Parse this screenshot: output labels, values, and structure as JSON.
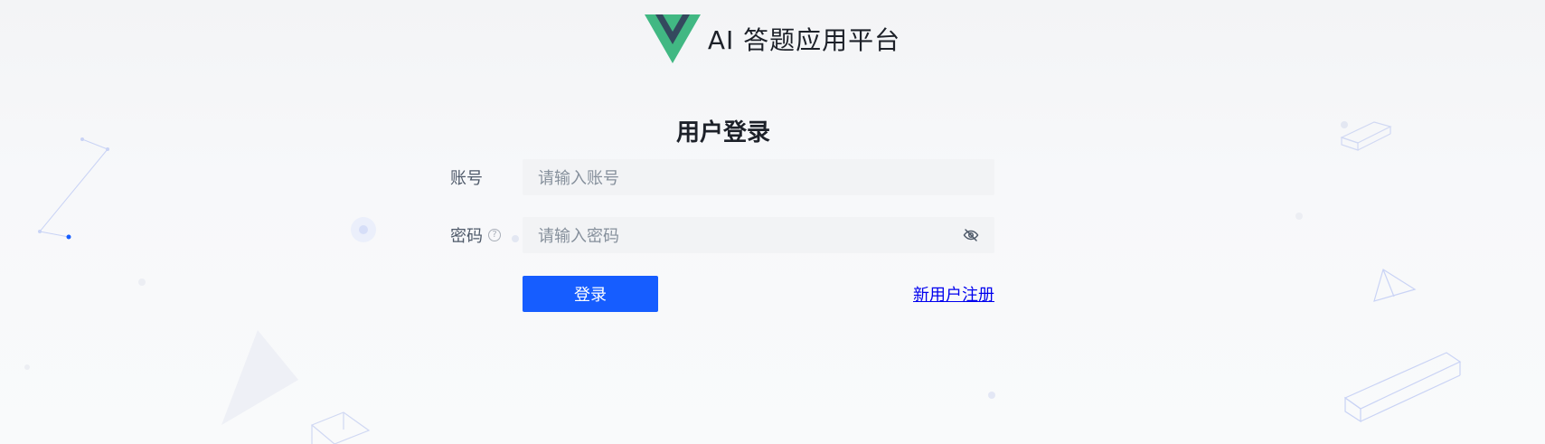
{
  "app": {
    "title": "AI 答题应用平台"
  },
  "login": {
    "title": "用户登录",
    "account_label": "账号",
    "account_placeholder": "请输入账号",
    "password_label": "密码",
    "password_placeholder": "请输入密码",
    "submit_label": "登录",
    "register_link": "新用户注册"
  },
  "icons": {
    "logo": "vue-logo-icon",
    "help": "question-circle-icon",
    "visibility": "eye-off-icon"
  },
  "colors": {
    "primary": "#165dff",
    "vue_green": "#41b883",
    "vue_dark": "#34495e",
    "input_bg": "#f2f3f5"
  }
}
